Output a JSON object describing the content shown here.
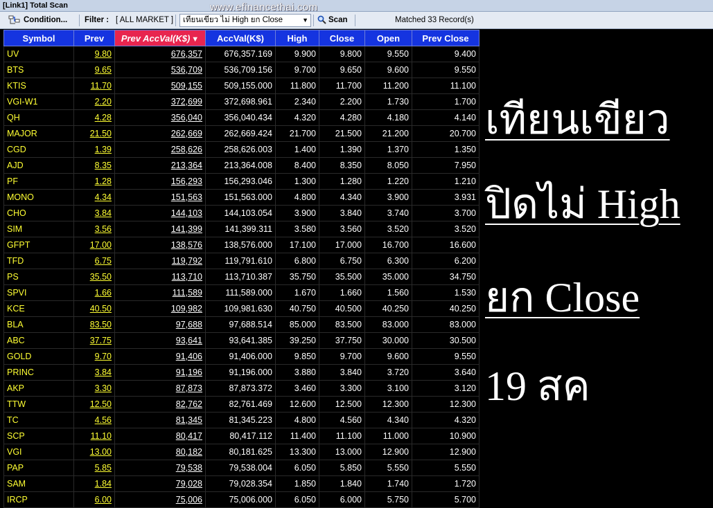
{
  "window": {
    "title": "[Link1] Total Scan"
  },
  "watermark": "www.efinancethai.com",
  "toolbar": {
    "condition_label": "Condition...",
    "filter_label": "Filter :",
    "filter_value": "[ ALL MARKET ]",
    "selected_condition": "เทียนเขียว  ไม่  High ยก  Close",
    "scan_label": "Scan",
    "matched_text": "Matched 33 Record(s)"
  },
  "table": {
    "columns": [
      "Symbol",
      "Prev",
      "Prev AccVal(K$)",
      "AccVal(K$)",
      "High",
      "Close",
      "Open",
      "Prev Close"
    ],
    "sorted_column": "Prev AccVal(K$)",
    "rows": [
      [
        "UV",
        "9.80",
        "676,357",
        "676,357.169",
        "9.900",
        "9.800",
        "9.550",
        "9.400"
      ],
      [
        "BTS",
        "9.65",
        "536,709",
        "536,709.156",
        "9.700",
        "9.650",
        "9.600",
        "9.550"
      ],
      [
        "KTIS",
        "11.70",
        "509,155",
        "509,155.000",
        "11.800",
        "11.700",
        "11.200",
        "11.100"
      ],
      [
        "VGI-W1",
        "2.20",
        "372,699",
        "372,698.961",
        "2.340",
        "2.200",
        "1.730",
        "1.700"
      ],
      [
        "QH",
        "4.28",
        "356,040",
        "356,040.434",
        "4.320",
        "4.280",
        "4.180",
        "4.140"
      ],
      [
        "MAJOR",
        "21.50",
        "262,669",
        "262,669.424",
        "21.700",
        "21.500",
        "21.200",
        "20.700"
      ],
      [
        "CGD",
        "1.39",
        "258,626",
        "258,626.003",
        "1.400",
        "1.390",
        "1.370",
        "1.350"
      ],
      [
        "AJD",
        "8.35",
        "213,364",
        "213,364.008",
        "8.400",
        "8.350",
        "8.050",
        "7.950"
      ],
      [
        "PF",
        "1.28",
        "156,293",
        "156,293.046",
        "1.300",
        "1.280",
        "1.220",
        "1.210"
      ],
      [
        "MONO",
        "4.34",
        "151,563",
        "151,563.000",
        "4.800",
        "4.340",
        "3.900",
        "3.931"
      ],
      [
        "CHO",
        "3.84",
        "144,103",
        "144,103.054",
        "3.900",
        "3.840",
        "3.740",
        "3.700"
      ],
      [
        "SIM",
        "3.56",
        "141,399",
        "141,399.311",
        "3.580",
        "3.560",
        "3.520",
        "3.520"
      ],
      [
        "GFPT",
        "17.00",
        "138,576",
        "138,576.000",
        "17.100",
        "17.000",
        "16.700",
        "16.600"
      ],
      [
        "TFD",
        "6.75",
        "119,792",
        "119,791.610",
        "6.800",
        "6.750",
        "6.300",
        "6.200"
      ],
      [
        "PS",
        "35.50",
        "113,710",
        "113,710.387",
        "35.750",
        "35.500",
        "35.000",
        "34.750"
      ],
      [
        "SPVI",
        "1.66",
        "111,589",
        "111,589.000",
        "1.670",
        "1.660",
        "1.560",
        "1.530"
      ],
      [
        "KCE",
        "40.50",
        "109,982",
        "109,981.630",
        "40.750",
        "40.500",
        "40.250",
        "40.250"
      ],
      [
        "BLA",
        "83.50",
        "97,688",
        "97,688.514",
        "85.000",
        "83.500",
        "83.000",
        "83.000"
      ],
      [
        "ABC",
        "37.75",
        "93,641",
        "93,641.385",
        "39.250",
        "37.750",
        "30.000",
        "30.500"
      ],
      [
        "GOLD",
        "9.70",
        "91,406",
        "91,406.000",
        "9.850",
        "9.700",
        "9.600",
        "9.550"
      ],
      [
        "PRINC",
        "3.84",
        "91,196",
        "91,196.000",
        "3.880",
        "3.840",
        "3.720",
        "3.640"
      ],
      [
        "AKP",
        "3.30",
        "87,873",
        "87,873.372",
        "3.460",
        "3.300",
        "3.100",
        "3.120"
      ],
      [
        "TTW",
        "12.50",
        "82,762",
        "82,761.469",
        "12.600",
        "12.500",
        "12.300",
        "12.300"
      ],
      [
        "TC",
        "4.56",
        "81,345",
        "81,345.223",
        "4.800",
        "4.560",
        "4.340",
        "4.320"
      ],
      [
        "SCP",
        "11.10",
        "80,417",
        "80,417.112",
        "11.400",
        "11.100",
        "11.000",
        "10.900"
      ],
      [
        "VGI",
        "13.00",
        "80,182",
        "80,181.625",
        "13.300",
        "13.000",
        "12.900",
        "12.900"
      ],
      [
        "PAP",
        "5.85",
        "79,538",
        "79,538.004",
        "6.050",
        "5.850",
        "5.550",
        "5.550"
      ],
      [
        "SAM",
        "1.84",
        "79,028",
        "79,028.354",
        "1.850",
        "1.840",
        "1.740",
        "1.720"
      ],
      [
        "IRCP",
        "6.00",
        "75,006",
        "75,006.000",
        "6.050",
        "6.000",
        "5.750",
        "5.700"
      ]
    ]
  },
  "annotation": {
    "line1": "เทียนเขียว",
    "line2": "ปิดไม่ High",
    "line3": "ยก Close",
    "line4": "19 สค"
  },
  "colors": {
    "header_bg": "#1534e0",
    "sorted_header_bg": "#e8254f",
    "symbol_text": "#ffff33",
    "grid_bg": "#000000"
  }
}
